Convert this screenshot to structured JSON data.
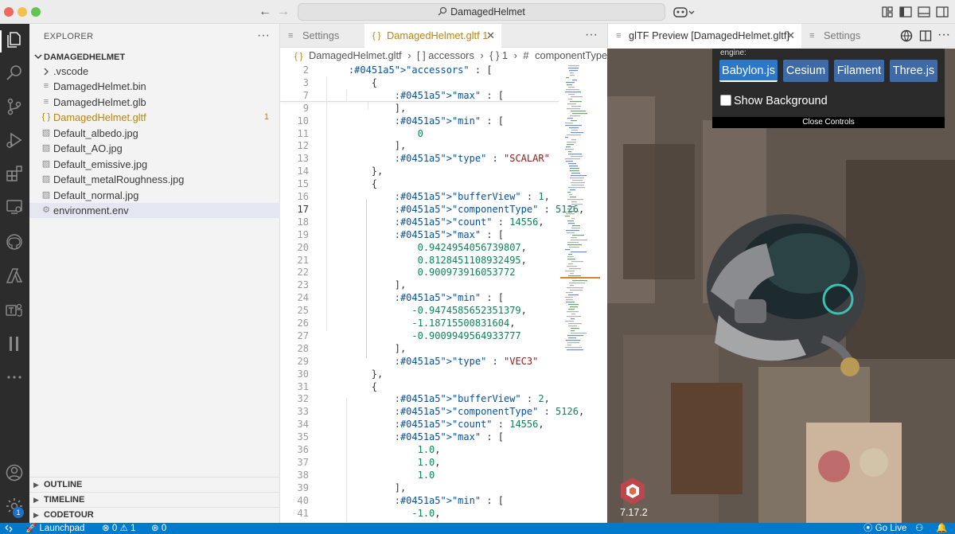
{
  "titlebar": {
    "search_text": "DamagedHelmet",
    "back_label": "←",
    "forward_label": "→"
  },
  "sidebar": {
    "title": "EXPLORER",
    "more": "···",
    "folder": "DAMAGEDHELMET",
    "items": [
      {
        "label": ".vscode",
        "kind": "folder"
      },
      {
        "label": "DamagedHelmet.bin",
        "kind": "file"
      },
      {
        "label": "DamagedHelmet.glb",
        "kind": "file"
      },
      {
        "label": "DamagedHelmet.gltf",
        "kind": "gltf",
        "badge": "1"
      },
      {
        "label": "Default_albedo.jpg",
        "kind": "image"
      },
      {
        "label": "Default_AO.jpg",
        "kind": "image"
      },
      {
        "label": "Default_emissive.jpg",
        "kind": "image"
      },
      {
        "label": "Default_metalRoughness.jpg",
        "kind": "image"
      },
      {
        "label": "Default_normal.jpg",
        "kind": "image"
      },
      {
        "label": "environment.env",
        "kind": "gear"
      }
    ],
    "sections": [
      "OUTLINE",
      "TIMELINE",
      "CODETOUR"
    ]
  },
  "editor_tabs": [
    {
      "label": "Settings",
      "active": false
    },
    {
      "label": "DamagedHelmet.gltf 1",
      "active": true
    }
  ],
  "breadcrumb": [
    "DamagedHelmet.gltf",
    "[ ] accessors",
    "{ } 1",
    "componentType"
  ],
  "breadcrumb_icons": {
    "file": "{ }",
    "hash": "#"
  },
  "code": [
    {
      "ln": "2",
      "text": "    \"accessors\" : ["
    },
    {
      "ln": "3",
      "text": "        {"
    },
    {
      "ln": "7",
      "text": "            \"max\" : ["
    },
    {
      "ln": "9",
      "text": "            ],"
    },
    {
      "ln": "10",
      "text": "            \"min\" : ["
    },
    {
      "ln": "11",
      "text": "                0"
    },
    {
      "ln": "12",
      "text": "            ],"
    },
    {
      "ln": "13",
      "text": "            \"type\" : \"SCALAR\""
    },
    {
      "ln": "14",
      "text": "        },"
    },
    {
      "ln": "15",
      "text": "        {"
    },
    {
      "ln": "16",
      "text": "            \"bufferView\" : 1,"
    },
    {
      "ln": "17",
      "text": "            \"componentType\" : 5126,"
    },
    {
      "ln": "18",
      "text": "            \"count\" : 14556,"
    },
    {
      "ln": "19",
      "text": "            \"max\" : ["
    },
    {
      "ln": "20",
      "text": "                0.9424954056739807,"
    },
    {
      "ln": "21",
      "text": "                0.8128451108932495,"
    },
    {
      "ln": "22",
      "text": "                0.900973916053772"
    },
    {
      "ln": "23",
      "text": "            ],"
    },
    {
      "ln": "24",
      "text": "            \"min\" : ["
    },
    {
      "ln": "25",
      "text": "               -0.9474585652351379,"
    },
    {
      "ln": "26",
      "text": "               -1.18715500831604,"
    },
    {
      "ln": "27",
      "text": "               -0.9009949564933777"
    },
    {
      "ln": "28",
      "text": "            ],"
    },
    {
      "ln": "29",
      "text": "            \"type\" : \"VEC3\""
    },
    {
      "ln": "30",
      "text": "        },"
    },
    {
      "ln": "31",
      "text": "        {"
    },
    {
      "ln": "32",
      "text": "            \"bufferView\" : 2,"
    },
    {
      "ln": "33",
      "text": "            \"componentType\" : 5126,"
    },
    {
      "ln": "34",
      "text": "            \"count\" : 14556,"
    },
    {
      "ln": "35",
      "text": "            \"max\" : ["
    },
    {
      "ln": "36",
      "text": "                1.0,"
    },
    {
      "ln": "37",
      "text": "                1.0,"
    },
    {
      "ln": "38",
      "text": "                1.0"
    },
    {
      "ln": "39",
      "text": "            ],"
    },
    {
      "ln": "40",
      "text": "            \"min\" : ["
    },
    {
      "ln": "41",
      "text": "               -1.0,"
    }
  ],
  "current_line": "17",
  "preview_tabs": [
    {
      "label": "glTF Preview [DamagedHelmet.gltf]",
      "active": true
    },
    {
      "label": "Settings",
      "active": false
    }
  ],
  "preview": {
    "engine_label": "engine:",
    "engines": [
      "Babylon.js",
      "Cesium",
      "Filament",
      "Three.js"
    ],
    "selected_engine": "Babylon.js",
    "show_background": "Show Background",
    "close_controls": "Close Controls",
    "version": "7.17.2"
  },
  "statusbar": {
    "launchpad": "Launchpad",
    "errors": "0",
    "warnings": "1",
    "ports": "0",
    "go_live": "Go Live"
  },
  "activity_badge": "1",
  "colors": {
    "accent": "#007acc",
    "engine_button": "#3e6aa8",
    "json_key": "#0451a5",
    "json_string": "#a31515",
    "json_number": "#098658"
  }
}
